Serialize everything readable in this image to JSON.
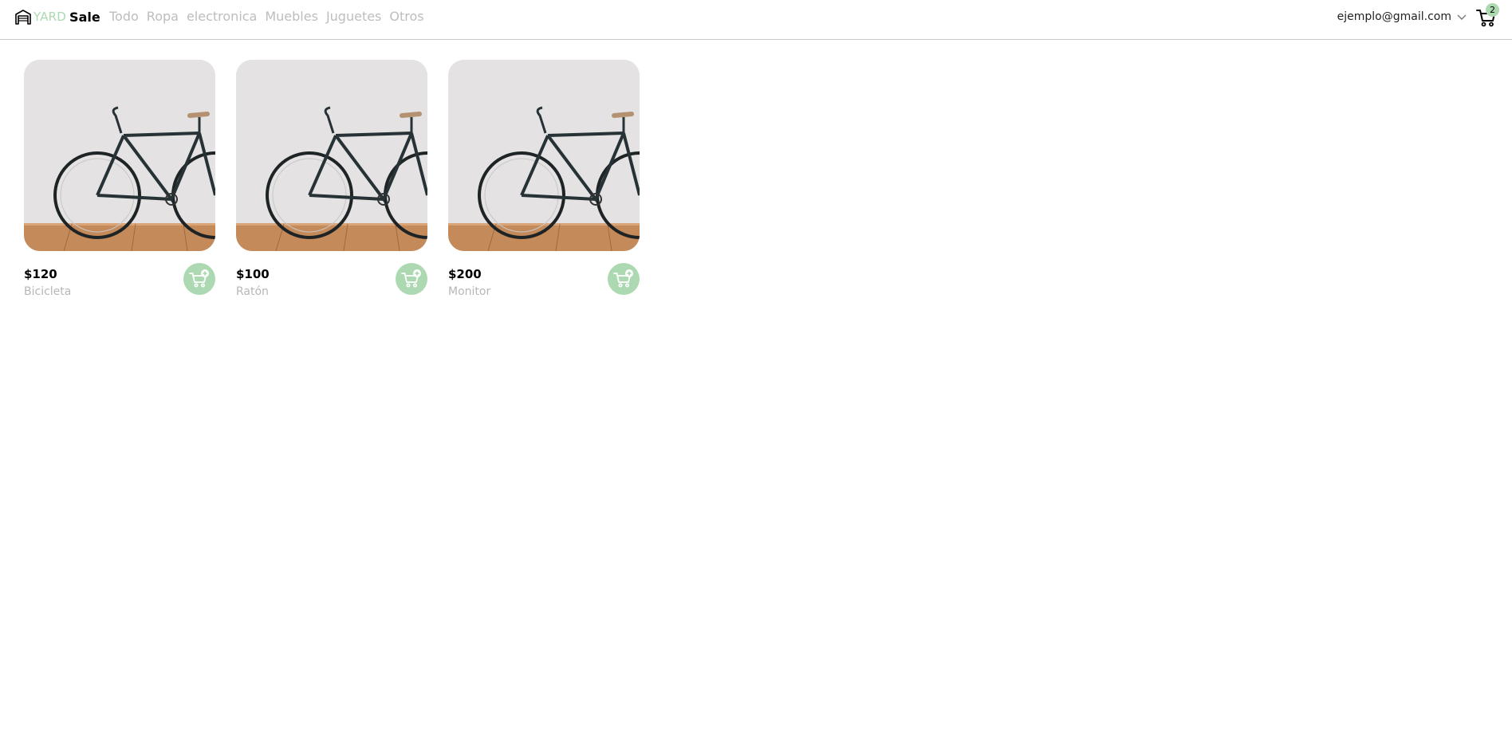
{
  "brand": {
    "yard": "YARD",
    "sale": "Sale"
  },
  "nav": {
    "items": [
      {
        "label": "Todo"
      },
      {
        "label": "Ropa"
      },
      {
        "label": "electronica"
      },
      {
        "label": "Muebles"
      },
      {
        "label": "Juguetes"
      },
      {
        "label": "Otros"
      }
    ]
  },
  "account": {
    "email": "ejemplo@gmail.com",
    "icon": "chevron-down-icon"
  },
  "cart": {
    "count": "2",
    "icon": "shopping-cart-icon"
  },
  "products": [
    {
      "price": "$120",
      "name": "Bicicleta",
      "image": "bicycle-photo"
    },
    {
      "price": "$100",
      "name": "Ratón",
      "image": "bicycle-photo"
    },
    {
      "price": "$200",
      "name": "Monitor",
      "image": "bicycle-photo"
    }
  ],
  "colors": {
    "accent": "#acd9b2",
    "muted_text": "#bdbdbd",
    "border": "#c9c9c9"
  }
}
